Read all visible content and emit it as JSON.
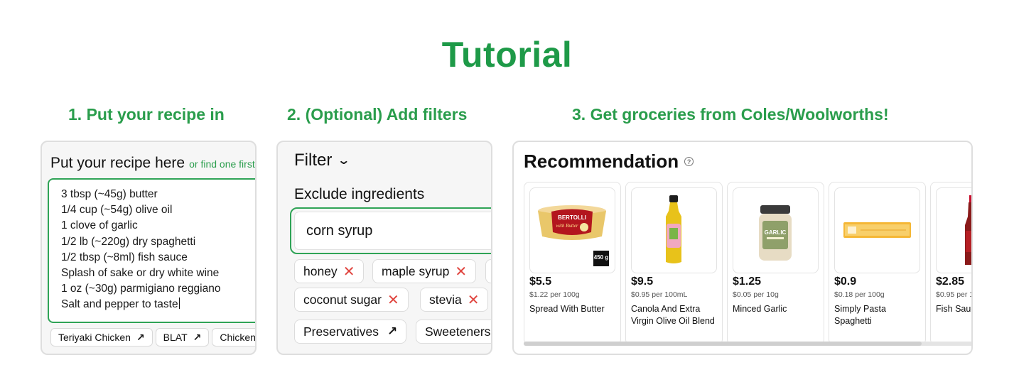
{
  "page": {
    "title": "Tutorial"
  },
  "steps": [
    {
      "label": "1. Put your recipe in"
    },
    {
      "label": "2. (Optional) Add filters"
    },
    {
      "label": "3. Get groceries from Coles/Woolworths!"
    }
  ],
  "recipe_panel": {
    "heading": "Put your recipe here",
    "link_text": "or find one first",
    "lines": [
      "3 tbsp (~45g) butter",
      "1/4 cup (~54g) olive oil",
      "1 clove of garlic",
      "1/2 lb (~220g) dry spaghetti",
      "1/2 tbsp (~8ml) fish sauce",
      "Splash of sake or dry white wine",
      "1 oz (~30g) parmigiano reggiano",
      "Salt and pepper to taste"
    ],
    "suggestions": [
      "Teriyaki Chicken",
      "BLAT",
      "Chicken"
    ]
  },
  "filter_panel": {
    "title": "Filter",
    "section_label": "Exclude ingredients",
    "input_value": "corn syrup",
    "excluded": [
      "honey",
      "maple syrup",
      "coconut sugar",
      "stevia"
    ],
    "presets": [
      "Preservatives",
      "Sweeteners"
    ]
  },
  "recommendation_panel": {
    "title": "Recommendation",
    "help_glyph": "?",
    "products": [
      {
        "price": "$5.5",
        "unit_price": "$1.22 per 100g",
        "name": "Spread With Butter",
        "badge": "450 g",
        "brand_text": "BERTOLLI",
        "sub_text": "with Butter"
      },
      {
        "price": "$9.5",
        "unit_price": "$0.95 per 100mL",
        "name": "Canola And Extra Virgin Olive Oil Blend"
      },
      {
        "price": "$1.25",
        "unit_price": "$0.05 per 10g",
        "name": "Minced Garlic",
        "label_text": "GARLIC"
      },
      {
        "price": "$0.9",
        "unit_price": "$0.18 per 100g",
        "name": "Simply Pasta Spaghetti"
      },
      {
        "price": "$2.85",
        "unit_price": "$0.95 per 1",
        "name": "Fish Sauce"
      }
    ]
  },
  "colors": {
    "accent": "#1e9a48",
    "focus_border": "#2fa356",
    "remove_x": "#e0443e"
  }
}
